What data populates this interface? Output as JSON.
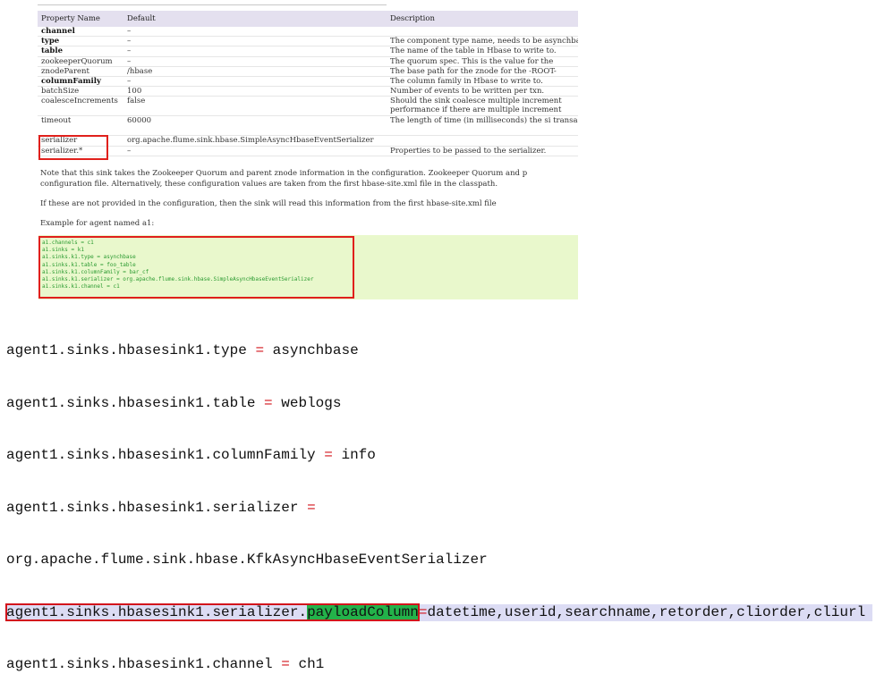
{
  "table": {
    "headers": [
      "Property Name",
      "Default",
      "Description"
    ],
    "rows": [
      {
        "name": "channel",
        "default": "–",
        "desc": "",
        "req": true
      },
      {
        "name": "type",
        "default": "–",
        "desc": "The component type name, needs to be asynchbase",
        "req": true
      },
      {
        "name": "table",
        "default": "–",
        "desc": "The name of the table in Hbase to write to.",
        "req": true
      },
      {
        "name": "zookeeperQuorum",
        "default": "–",
        "desc": "The quorum spec. This is the value for the",
        "req": false
      },
      {
        "name": "znodeParent",
        "default": "/hbase",
        "desc": "The base path for the znode for the -ROOT-",
        "req": false
      },
      {
        "name": "columnFamily",
        "default": "–",
        "desc": "The column family in Hbase to write to.",
        "req": true
      },
      {
        "name": "batchSize",
        "default": "100",
        "desc": "Number of events to be written per txn.",
        "req": false
      },
      {
        "name": "coalesceIncrements",
        "default": "false",
        "desc": "Should the sink coalesce multiple increment performance if there are multiple increment",
        "req": false,
        "tall": true
      },
      {
        "name": "timeout",
        "default": "60000",
        "desc": "The length of time (in milliseconds) the si transaction.",
        "req": false,
        "tall": true
      },
      {
        "name": "serializer",
        "default": "org.apache.flume.sink.hbase.SimpleAsyncHbaseEventSerializer",
        "desc": "",
        "req": false
      },
      {
        "name": "serializer.*",
        "default": "–",
        "desc": "Properties to be passed to the serializer.",
        "req": false
      }
    ]
  },
  "notes": {
    "line1": "Note that this sink takes the Zookeeper Quorum and parent znode information in the configuration. Zookeeper Quorum and p",
    "line2": "configuration file. Alternatively, these configuration values are taken from the first hbase-site.xml file in the classpath.",
    "line3": "If these are not provided in the configuration, then the sink will read this information from the first hbase-site.xml file",
    "line4": "Example for agent named a1:"
  },
  "example": {
    "lines": [
      "a1.channels = c1",
      "a1.sinks = k1",
      "a1.sinks.k1.type = asynchbase",
      "a1.sinks.k1.table = foo_table",
      "a1.sinks.k1.columnFamily = bar_cf",
      "a1.sinks.k1.serializer = org.apache.flume.sink.hbase.SimpleAsyncHbaseEventSerializer",
      "a1.sinks.k1.channel = c1"
    ]
  },
  "config": {
    "l1_key": "agent1.sinks.hbasesink1.type ",
    "l1_val": " asynchbase",
    "l2_key": "agent1.sinks.hbasesink1.table ",
    "l2_val": " weblogs",
    "l3_key": "agent1.sinks.hbasesink1.columnFamily ",
    "l3_val": " info",
    "l4_key": "agent1.sinks.hbasesink1.serializer ",
    "l4_val": "",
    "l5_text": "org.apache.flume.sink.hbase.KfkAsyncHbaseEventSerializer",
    "l6_key": "agent1.sinks.hbasesink1.serializer.",
    "l6_hl": "payloadColumn",
    "l6_val": "datetime,userid,searchname,retorder,cliorder,cliurl",
    "l7_key": "agent1.sinks.hbasesink1.channel ",
    "l7_val": " ch1",
    "eq": "="
  },
  "colors": {
    "redbox": "#e0201c",
    "codeBg": "#e9f8cc",
    "codeText": "#2a9a30",
    "highlight": "#23b24a",
    "headerBg": "#e4e0ef"
  }
}
